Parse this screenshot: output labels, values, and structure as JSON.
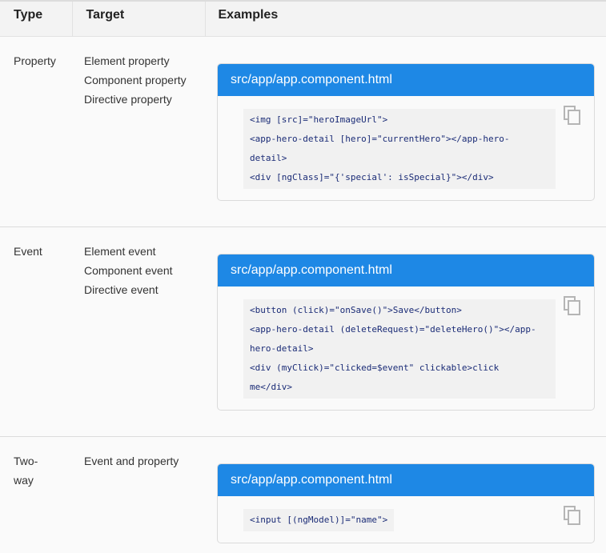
{
  "headers": {
    "type": "Type",
    "target": "Target",
    "examples": "Examples"
  },
  "rows": [
    {
      "type": "Property",
      "targets": [
        "Element property",
        "Component property",
        "Directive property"
      ],
      "example": {
        "filename": "src/app/app.component.html",
        "lines": [
          "<img [src]=\"heroImageUrl\">",
          "<app-hero-detail [hero]=\"currentHero\"></app-hero-",
          "detail>",
          "<div [ngClass]=\"{'special': isSpecial}\"></div>"
        ]
      }
    },
    {
      "type": "Event",
      "targets": [
        "Element event",
        "Component event",
        "Directive event"
      ],
      "example": {
        "filename": "src/app/app.component.html",
        "lines": [
          "<button (click)=\"onSave()\">Save</button>",
          "<app-hero-detail (deleteRequest)=\"deleteHero()\"></app-",
          "hero-detail>",
          "<div (myClick)=\"clicked=$event\" clickable>click",
          "me</div>"
        ]
      }
    },
    {
      "type": "Two-way",
      "type_lines": [
        "Two-",
        "way"
      ],
      "targets": [
        "Event and property"
      ],
      "example": {
        "filename": "src/app/app.component.html",
        "lines": [
          "<input [(ngModel)]=\"name\">"
        ]
      }
    }
  ],
  "icons": {
    "copy": "copy-icon"
  },
  "colors": {
    "header_blue": "#1e88e5",
    "code_bg": "#f1f1f1",
    "table_header_bg": "#f3f3f3",
    "row_bg": "#fafafa"
  }
}
